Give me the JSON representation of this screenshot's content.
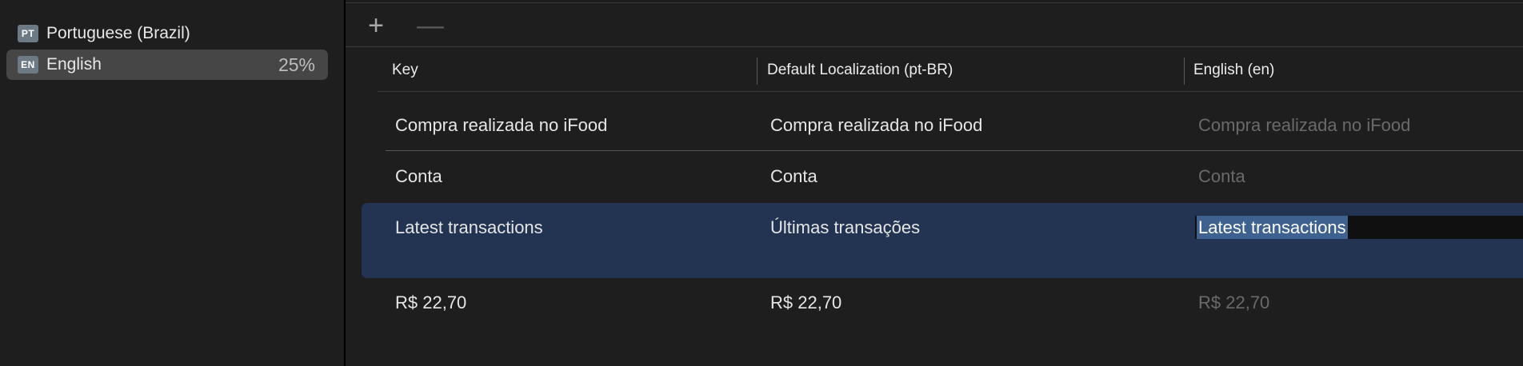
{
  "sidebar": {
    "languages": [
      {
        "code": "PT",
        "name": "Portuguese (Brazil)",
        "percent": ""
      },
      {
        "code": "EN",
        "name": "English",
        "percent": "25%"
      }
    ]
  },
  "toolbar": {
    "add_label": "+",
    "remove_label": "—"
  },
  "table": {
    "columns": [
      "Key",
      "Default Localization (pt-BR)",
      "English (en)"
    ],
    "rows": [
      {
        "key": "Compra realizada no iFood",
        "default": "Compra realizada no iFood",
        "english": "Compra realizada no iFood",
        "english_translated": false
      },
      {
        "key": "Conta",
        "default": "Conta",
        "english": "Conta",
        "english_translated": false
      },
      {
        "key": "Latest transactions",
        "default": "Últimas transações",
        "english": "Latest transactions",
        "english_translated": true,
        "selected": true,
        "editing": true
      },
      {
        "key": "R$ 22,70",
        "default": "R$ 22,70",
        "english": "R$ 22,70",
        "english_translated": false
      }
    ]
  },
  "colors": {
    "selection": "#223451",
    "text_highlight": "#3e6190",
    "untranslated_text": "#6a6a6a",
    "language_badge": "#6c7a86"
  },
  "icons": [
    "plus-icon",
    "minus-icon"
  ]
}
